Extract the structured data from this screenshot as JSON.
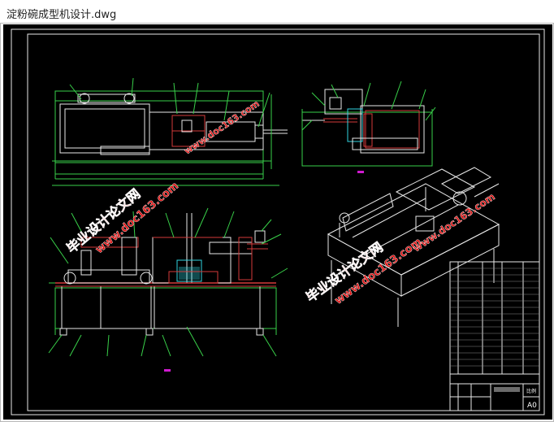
{
  "window": {
    "title": "淀粉碗成型机设计.dwg"
  },
  "drawing": {
    "watermark_cn": "毕业设计论文网",
    "watermark_url": "www.doc163.com",
    "title_block": {
      "scale_label": "比例",
      "sheet_size": "A0"
    },
    "colors": {
      "background": "#000000",
      "frame": "#ffffff",
      "outline_green": "#39d14a",
      "part_white": "#e8e8e8",
      "hatch_red": "#d43a3a",
      "accent_magenta": "#d01ad0",
      "cyan": "#2fd4e0",
      "watermark_red": "#e01010"
    }
  }
}
